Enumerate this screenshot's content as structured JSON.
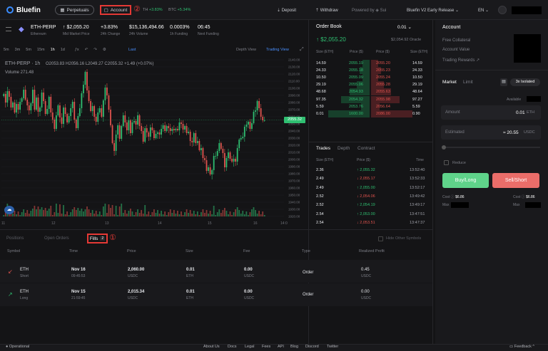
{
  "topbar": {
    "logo": "Bluefin",
    "perpetuals": "Perpetuals",
    "account": "Account",
    "annotation_account": "②",
    "ticker_eth": "TH",
    "ticker_eth_change": "+3.83%",
    "ticker_btc": "BTC",
    "ticker_btc_change": "+5.34%",
    "deposit": "Deposit",
    "withdraw": "Withdraw",
    "powered_by": "Powered by",
    "sui": "Sui",
    "release": "Bluefin V2 Early Release",
    "language": "EN"
  },
  "market": {
    "symbol": "ETH-PERP",
    "name": "Ethereum",
    "mid_price": "↑ $2,055.20",
    "mid_price_label": "Mid Market Price",
    "change": "+3.83%",
    "change_label": "24h Change",
    "volume": "$15,136,494.66",
    "volume_label": "24h Volume",
    "funding": "0.0003%",
    "funding_label": "1h Funding",
    "next_funding": "06:45",
    "next_funding_label": "Next Funding"
  },
  "chart_toolbar": {
    "intervals": [
      "5m",
      "3m",
      "5m",
      "15m",
      "1h",
      "1d"
    ],
    "last": "Last",
    "depth_view": "Depth View",
    "trading_view": "Trading View"
  },
  "chart_data": {
    "type": "candlestick",
    "title": "ETH-PERP · 1h",
    "ohlc_text": "O2053.83 H2056.16 L2049.27 C2055.32 +1.49 (+0.07%)",
    "volume_text": "Volume 271.48",
    "y_ticks": [
      "2140.00",
      "2130.00",
      "2120.00",
      "2110.00",
      "2100.00",
      "2090.00",
      "2080.00",
      "2070.00",
      "2060.00",
      "2050.00",
      "2040.00",
      "2030.00",
      "2020.00",
      "2010.00",
      "2000.00",
      "1990.00",
      "1980.00",
      "1970.00",
      "1960.00",
      "1950.00",
      "1940.00",
      "1930.00",
      "1920.00"
    ],
    "x_ticks": [
      "11",
      "12",
      "13",
      "14",
      "15",
      "16",
      "14:0"
    ],
    "last_price_label": "2055.32",
    "ylim": [
      1920,
      2140
    ],
    "closes": [
      2092,
      2080,
      2096,
      2088,
      2073,
      2080,
      2066,
      2078,
      2070,
      2081,
      2086,
      2098,
      2084,
      2076,
      2069,
      2079,
      2098,
      2070,
      2087,
      2067,
      2073,
      2094,
      2082,
      2064,
      2071,
      2088,
      2066,
      2056,
      2043,
      2062,
      2076,
      2059,
      2050,
      2073,
      2064,
      2052,
      2061,
      2072,
      2081,
      2056,
      2044,
      2061,
      2072,
      2093,
      2105,
      2123,
      2097,
      2082,
      2068,
      2075,
      2060,
      2053,
      2066,
      2072,
      2060,
      2083,
      2101,
      2090,
      2070,
      2048,
      2023,
      2012,
      2035,
      2048,
      2029,
      2047,
      2062,
      2052,
      2041,
      2055,
      2037,
      2052,
      2054,
      2049,
      2062,
      2047,
      2040,
      2025,
      2044,
      2038,
      2032,
      2045,
      2041,
      2030,
      2036,
      2038,
      2035,
      2043,
      2048,
      2040,
      2047,
      2044,
      2040,
      2043,
      2041,
      2043,
      2041,
      2052,
      2050,
      2042,
      2047,
      2037,
      2039,
      2026,
      2024,
      2037,
      2023,
      2026,
      2013,
      2016,
      2002,
      1999,
      1984,
      1989,
      1979,
      1985,
      2005,
      2005,
      2012,
      2023,
      2015,
      2009,
      1989,
      2002,
      2010,
      2001,
      1997,
      2001,
      1997,
      2016,
      2028,
      2030,
      2032,
      2046,
      2049,
      2053,
      2043,
      2051,
      2067,
      2069,
      2082,
      2072,
      2060,
      2055,
      2055
    ]
  },
  "orderbook": {
    "title": "Order Book",
    "step": "0.01",
    "mid": "↑ $2,055.20",
    "oracle": "$2,054.92 Oracle",
    "col_size": "Size (ETH)",
    "col_price": "Price ($)",
    "bids": [
      {
        "size": "14.59",
        "price": "2055.19"
      },
      {
        "size": "24.33",
        "price": "2055.18"
      },
      {
        "size": "10.50",
        "price": "2055.09"
      },
      {
        "size": "29.19",
        "price": "2055.06"
      },
      {
        "size": "48.68",
        "price": "2054.93"
      },
      {
        "size": "97.35",
        "price": "2054.32"
      },
      {
        "size": "5.59",
        "price": "2053.76"
      },
      {
        "size": "0.01",
        "price": "1600.00"
      }
    ],
    "asks": [
      {
        "size": "14.59",
        "price": "2055.20"
      },
      {
        "size": "24.33",
        "price": "2055.23"
      },
      {
        "size": "10.50",
        "price": "2055.24"
      },
      {
        "size": "29.19",
        "price": "2055.28"
      },
      {
        "size": "48.64",
        "price": "2055.63"
      },
      {
        "size": "97.27",
        "price": "2055.98"
      },
      {
        "size": "5.59",
        "price": "2056.64"
      },
      {
        "size": "0.90",
        "price": "2086.00"
      }
    ]
  },
  "trades": {
    "tabs": [
      "Trades",
      "Depth",
      "Contract"
    ],
    "col_size": "Size (ETH)",
    "col_price": "Price ($)",
    "col_time": "Time",
    "rows": [
      {
        "size": "2.36",
        "price": "↑ 2,055.32",
        "time": "13:52:40",
        "up": true
      },
      {
        "size": "2.49",
        "price": "↓ 2,055.17",
        "time": "13:52:33",
        "up": false
      },
      {
        "size": "2.49",
        "price": "↑ 2,055.00",
        "time": "13:52:17",
        "up": true
      },
      {
        "size": "2.52",
        "price": "↓ 2,054.06",
        "time": "13:49:42",
        "up": false
      },
      {
        "size": "2.52",
        "price": "↑ 2,054.19",
        "time": "13:49:17",
        "up": true
      },
      {
        "size": "2.54",
        "price": "↑ 2,053.00",
        "time": "13:47:51",
        "up": true
      },
      {
        "size": "2.54",
        "price": "↓ 2,053.51",
        "time": "13:47:37",
        "up": false
      }
    ]
  },
  "right_panel": {
    "title": "Account",
    "free_collateral": "Free Collateral",
    "account_value": "Account Value",
    "trading_rewards": "Trading Rewards ↗",
    "tab_market": "Market",
    "tab_limit": "Limit",
    "leverage": "3x Isolated",
    "available": "Available",
    "amount_label": "Amount",
    "amount_value": "0.01",
    "amount_unit": "ETH",
    "estimated_label": "Estimated",
    "estimated_value": "≈ 20.55",
    "estimated_unit": "USDC",
    "reduce": "Reduce",
    "buy": "Buy/Long",
    "sell": "Sell/Short",
    "cost": "Cost",
    "cost_value": "$6.86",
    "max": "Max"
  },
  "bottom": {
    "tab_positions": "Positions",
    "tab_open_orders": "Open Orders",
    "tab_fills": "Fills",
    "fills_count": "2",
    "annotation_fills": "①",
    "hide_other": "Hide Other Symbols",
    "headers": [
      "Symbol",
      "Time",
      "Price",
      "Size",
      "Fee",
      "Type",
      "Realized Profit"
    ],
    "rows": [
      {
        "symbol": "ETH",
        "side": "Short",
        "date": "Nov 16",
        "time": "09:45:53",
        "price": "2,060.00",
        "price_unit": "USDC",
        "size": "0.01",
        "size_unit": "ETH",
        "fee": "0.00",
        "fee_unit": "USDC",
        "type": "Order",
        "profit": "0.45",
        "profit_unit": "USDC"
      },
      {
        "symbol": "ETH",
        "side": "Long",
        "date": "Nov 15",
        "time": "21:59:45",
        "price": "2,015.34",
        "price_unit": "USDC",
        "size": "0.01",
        "size_unit": "ETH",
        "fee": "0.00",
        "fee_unit": "USDC",
        "type": "Order",
        "profit": "0.00",
        "profit_unit": "USDC"
      }
    ]
  },
  "footer": {
    "status": "Operational",
    "links": [
      "About Us",
      "Docs",
      "Legal",
      "Fees",
      "API",
      "Blog",
      "Discord",
      "Twitter"
    ],
    "feedback": "Feedback"
  },
  "colors": {
    "green": "#2fbf71",
    "red": "#e0534e",
    "accent": "#4a90ff",
    "annotation": "#e53935"
  }
}
